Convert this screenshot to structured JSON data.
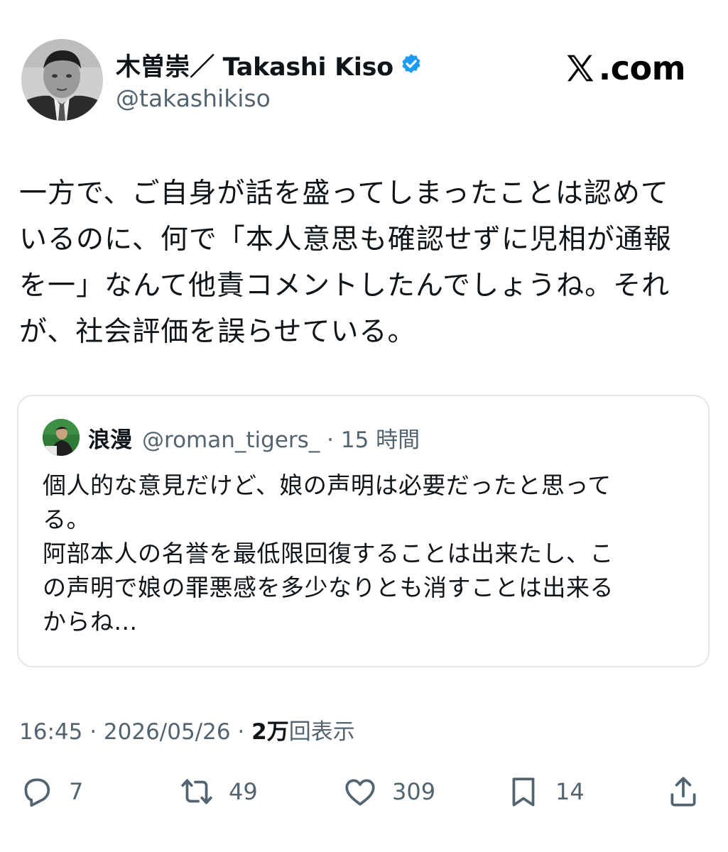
{
  "author": {
    "display_name": "木曽崇／ Takashi Kiso",
    "handle": "@takashikiso",
    "verified": true
  },
  "brand": {
    "label": ".com"
  },
  "tweet": {
    "lines": [
      "一方で、ご自身が話を盛ってしまったことは認めて",
      "いるのに、何で「本人意思も確認せずに児相が通報",
      "を一」なんて他責コメントしたんでしょうね。それ",
      "が、社会評価を誤らせている。"
    ]
  },
  "quote": {
    "name": "浪漫",
    "meta": "@roman_tigers_ · 15 時間",
    "lines": [
      "個人的な意見だけど、娘の声明は必要だったと思って",
      "る。",
      "阿部本人の名誉を最低限回復することは出来たし、こ",
      "の声明で娘の罪悪感を多少なりとも消すことは出来る",
      "からね..."
    ]
  },
  "meta": {
    "time_date": "16:45 · 2026/05/26 · ",
    "views_count": "2万",
    "views_label": "回表示"
  },
  "actions": {
    "replies": "7",
    "reposts": "49",
    "likes": "309",
    "bookmarks": "14"
  },
  "colors": {
    "text": "#0f1419",
    "secondary": "#536471",
    "verified": "#1d9bf0",
    "border": "#e1e6ea"
  }
}
